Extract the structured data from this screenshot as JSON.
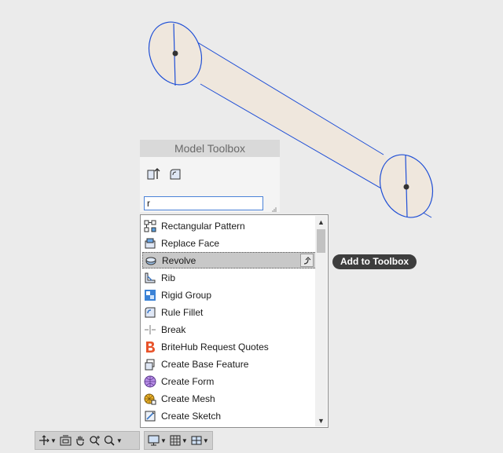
{
  "toolbox": {
    "title": "Model Toolbox",
    "search_value": "r",
    "icons": [
      "extrude-icon",
      "fillet-icon"
    ]
  },
  "dropdown": {
    "items": [
      {
        "label": "Rectangular Pattern",
        "icon": "rectangular-pattern-icon"
      },
      {
        "label": "Replace Face",
        "icon": "replace-face-icon"
      },
      {
        "label": "Revolve",
        "icon": "revolve-icon",
        "selected": true
      },
      {
        "label": "Rib",
        "icon": "rib-icon"
      },
      {
        "label": "Rigid Group",
        "icon": "rigid-group-icon"
      },
      {
        "label": "Rule Fillet",
        "icon": "rule-fillet-icon"
      },
      {
        "label": "Break",
        "icon": "break-icon"
      },
      {
        "label": "BriteHub Request Quotes",
        "icon": "britehub-icon"
      },
      {
        "label": "Create Base Feature",
        "icon": "create-base-feature-icon"
      },
      {
        "label": "Create Form",
        "icon": "create-form-icon"
      },
      {
        "label": "Create Mesh",
        "icon": "create-mesh-icon"
      },
      {
        "label": "Create Sketch",
        "icon": "create-sketch-icon"
      }
    ],
    "add_button_icon": "add-to-toolbox-icon"
  },
  "tooltip": {
    "text": "Add to Toolbox"
  },
  "colors": {
    "model_fill": "#efe7dd",
    "model_edge": "#1f4fd6",
    "tooltip_bg": "#3d3d3d",
    "selection": "#c8c8c8"
  }
}
